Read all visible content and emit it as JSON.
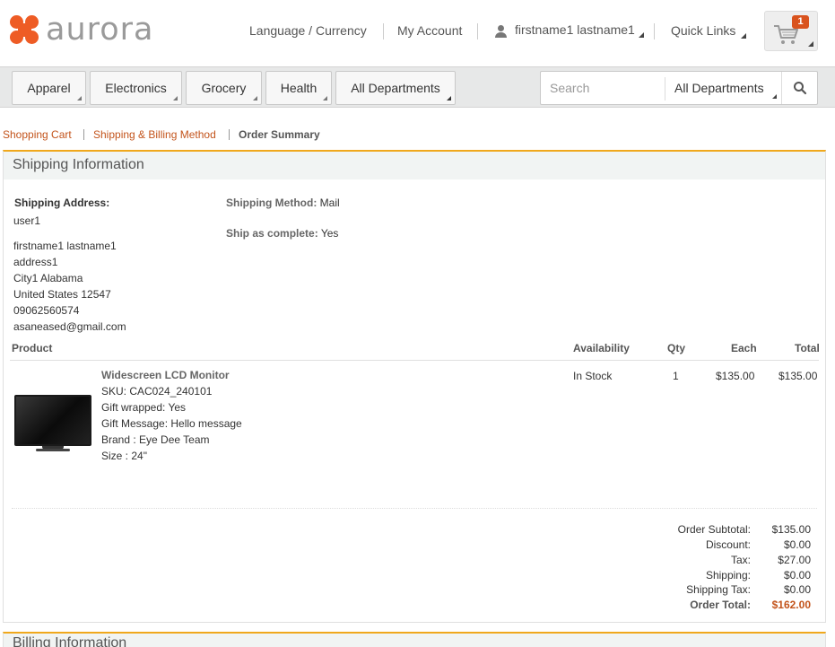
{
  "brand": {
    "name": "aurora"
  },
  "header": {
    "language_currency": "Language / Currency",
    "my_account": "My Account",
    "user_name": "firstname1 lastname1",
    "quick_links": "Quick Links",
    "cart_count": "1"
  },
  "nav": {
    "departments": [
      "Apparel",
      "Electronics",
      "Grocery",
      "Health",
      "All Departments"
    ],
    "search_placeholder": "Search",
    "search_department": "All Departments"
  },
  "breadcrumb": {
    "step1": "Shopping Cart",
    "step2": "Shipping & Billing Method",
    "step3": "Order Summary"
  },
  "shipping": {
    "title": "Shipping Information",
    "address_label": "Shipping Address:",
    "nickname": "user1",
    "address_lines": [
      "firstname1 lastname1",
      "address1",
      "City1 Alabama",
      "United States 12547",
      "09062560574",
      "asaneased@gmail.com"
    ],
    "method_label": "Shipping Method:",
    "method_value": "Mail",
    "complete_label": "Ship as complete:",
    "complete_value": "Yes"
  },
  "table": {
    "headers": {
      "product": "Product",
      "availability": "Availability",
      "qty": "Qty",
      "each": "Each",
      "total": "Total"
    },
    "rows": [
      {
        "name": "Widescreen LCD Monitor",
        "details": [
          "SKU: CAC024_240101",
          "Gift wrapped: Yes",
          "Gift Message: Hello message",
          "Brand : Eye Dee Team",
          "Size : 24\""
        ],
        "availability": "In Stock",
        "qty": "1",
        "each": "$135.00",
        "total": "$135.00"
      }
    ]
  },
  "totals": {
    "subtotal_label": "Order Subtotal:",
    "subtotal": "$135.00",
    "discount_label": "Discount:",
    "discount": "$0.00",
    "tax_label": "Tax:",
    "tax": "$27.00",
    "shipping_label": "Shipping:",
    "shipping": "$0.00",
    "shipping_tax_label": "Shipping Tax:",
    "shipping_tax": "$0.00",
    "order_total_label": "Order Total:",
    "order_total": "$162.00"
  },
  "billing": {
    "title": "Billing Information"
  },
  "colors": {
    "accent": "#ee5c25",
    "link": "#c3541c",
    "panel_rule": "#f0a81c"
  }
}
